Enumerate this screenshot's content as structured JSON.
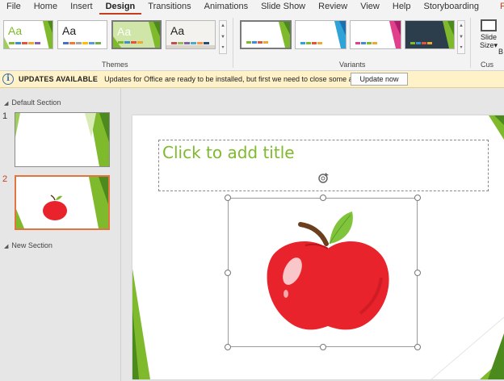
{
  "tabs": [
    {
      "label": "File"
    },
    {
      "label": "Home"
    },
    {
      "label": "Insert"
    },
    {
      "label": "Design"
    },
    {
      "label": "Transitions"
    },
    {
      "label": "Animations"
    },
    {
      "label": "Slide Show"
    },
    {
      "label": "Review"
    },
    {
      "label": "View"
    },
    {
      "label": "Help"
    },
    {
      "label": "Storyboarding"
    },
    {
      "label": "Format"
    }
  ],
  "ribbon": {
    "themes_label": "Themes",
    "variants_label": "Variants",
    "theme_thumbs": [
      {
        "text": "Aa",
        "text_color": "#7fb92c"
      },
      {
        "text": "Aa",
        "text_color": "#222222"
      },
      {
        "text": "Aa",
        "text_color": "#ffffff"
      },
      {
        "text": "Aa",
        "text_color": "#222222"
      }
    ],
    "slide_size_label_1": "Slide",
    "slide_size_label_2": "Size",
    "slide_size_caret": "▾",
    "cut_b": "B",
    "cut_custom": "Cus"
  },
  "update_bar": {
    "title": "UPDATES AVAILABLE",
    "message": "Updates for Office are ready to be installed, but first we need to close some apps.",
    "button": "Update now",
    "icon": "info-icon"
  },
  "slides_panel": {
    "section1": "Default Section",
    "section2": "New Section",
    "slide_numbers": [
      "1",
      "2"
    ]
  },
  "slide": {
    "title_placeholder": "Click to add title"
  },
  "colors": {
    "accent": "#c43e1c",
    "theme_green": "#7fb92c",
    "apple_red": "#e8232b",
    "update_bg": "#fff1c8"
  }
}
